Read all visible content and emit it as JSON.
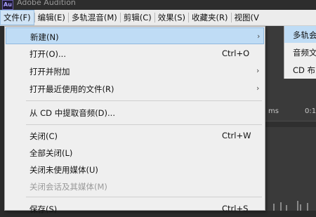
{
  "window": {
    "title": "Adobe Audition",
    "icon_text": "Au"
  },
  "menubar": {
    "items": [
      "文件(F)",
      "编辑(E)",
      "多轨混音(M)",
      "剪辑(C)",
      "效果(S)",
      "收藏夹(R)",
      "视图(V"
    ]
  },
  "file_menu": {
    "items": [
      {
        "label": "新建(N)",
        "shortcut": "",
        "arrow": "›"
      },
      {
        "label": "打开(O)...",
        "shortcut": "Ctrl+O",
        "arrow": ""
      },
      {
        "label": "打开并附加",
        "shortcut": "",
        "arrow": "›"
      },
      {
        "label": "打开最近使用的文件(R)",
        "shortcut": "",
        "arrow": "›"
      },
      {
        "label": "从 CD 中提取音频(D)...",
        "shortcut": "",
        "arrow": ""
      },
      {
        "label": "关闭(C)",
        "shortcut": "Ctrl+W",
        "arrow": ""
      },
      {
        "label": "全部关闭(L)",
        "shortcut": "",
        "arrow": ""
      },
      {
        "label": "关闭未使用媒体(U)",
        "shortcut": "",
        "arrow": ""
      },
      {
        "label": "关闭会话及其媒体(M)",
        "shortcut": "",
        "arrow": ""
      },
      {
        "label": "保存(S)",
        "shortcut": "Ctrl+S",
        "arrow": ""
      }
    ]
  },
  "new_submenu": {
    "items": [
      "多轨会",
      "音频文",
      "CD 布"
    ]
  },
  "workspace": {
    "ruler_labels": [
      "ms",
      "0:1"
    ]
  }
}
